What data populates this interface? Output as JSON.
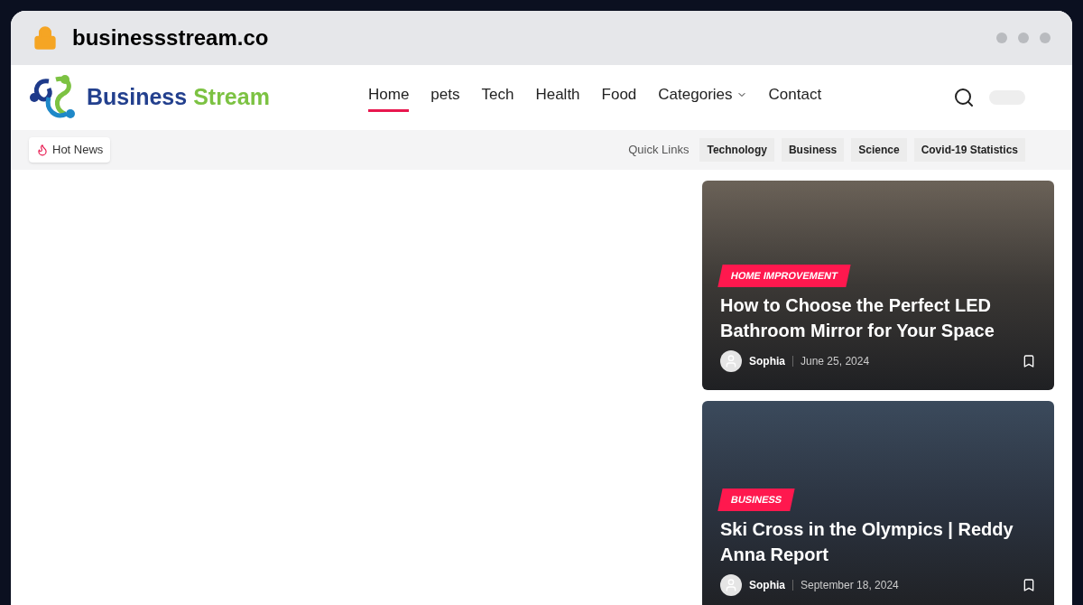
{
  "address_bar": {
    "url": "businessstream.co"
  },
  "logo": {
    "word_1": "Business",
    "word_2": "Stream"
  },
  "nav": [
    {
      "label": "Home",
      "selected": true,
      "dropdown": false
    },
    {
      "label": "pets",
      "selected": false,
      "dropdown": false
    },
    {
      "label": "Tech",
      "selected": false,
      "dropdown": false
    },
    {
      "label": "Health",
      "selected": false,
      "dropdown": false
    },
    {
      "label": "Food",
      "selected": false,
      "dropdown": false
    },
    {
      "label": "Categories",
      "selected": false,
      "dropdown": true
    },
    {
      "label": "Contact",
      "selected": false,
      "dropdown": false
    }
  ],
  "hot_news": {
    "label": "Hot News"
  },
  "quick_links": {
    "label": "Quick Links",
    "items": [
      "Technology",
      "Business",
      "Science",
      "Covid-19 Statistics"
    ]
  },
  "posts": [
    {
      "category": "HOME IMPROVEMENT",
      "title": "How to Choose the Perfect LED Bathroom Mirror for Your Space",
      "author": "Sophia",
      "date": "June 25, 2024"
    },
    {
      "category": "BUSINESS",
      "title": "Ski Cross in the Olympics | Reddy Anna Report",
      "author": "Sophia",
      "date": "September 18, 2024"
    }
  ]
}
